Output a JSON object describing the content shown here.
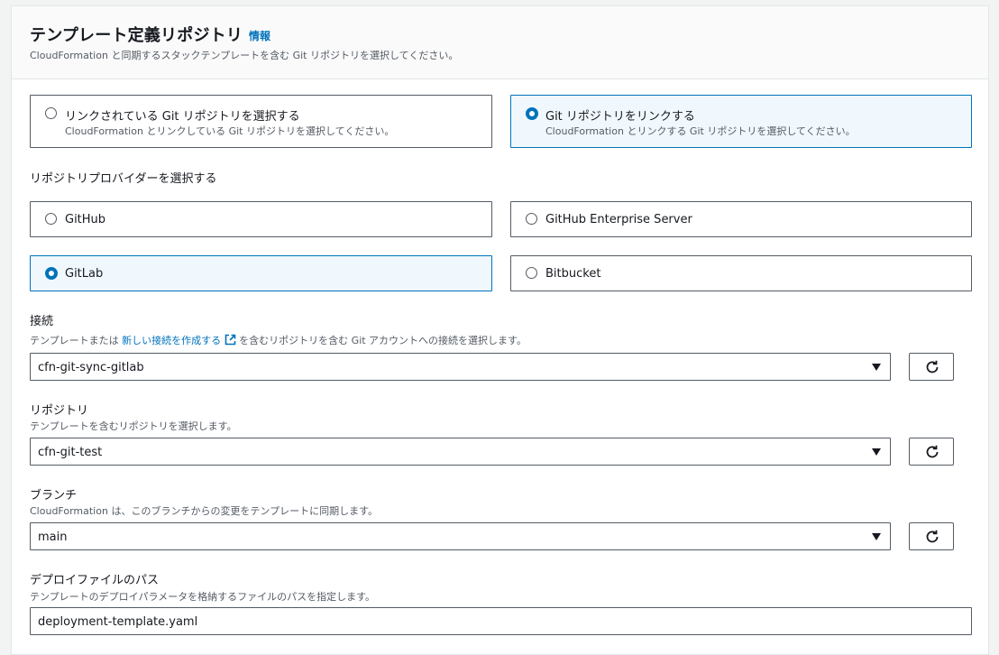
{
  "header": {
    "title": "テンプレート定義リポジトリ",
    "info": "情報",
    "description": "CloudFormation と同期するスタックテンプレートを含む Git リポジトリを選択してください。"
  },
  "repo_mode": {
    "options": [
      {
        "label": "リンクされている Git リポジトリを選択する",
        "description": "CloudFormation とリンクしている Git リポジトリを選択してください。",
        "selected": false
      },
      {
        "label": "Git リポジトリをリンクする",
        "description": "CloudFormation とリンクする Git リポジトリを選択してください。",
        "selected": true
      }
    ]
  },
  "provider": {
    "label": "リポジトリプロバイダーを選択する",
    "options": [
      {
        "label": "GitHub",
        "selected": false
      },
      {
        "label": "GitHub Enterprise Server",
        "selected": false
      },
      {
        "label": "GitLab",
        "selected": true
      },
      {
        "label": "Bitbucket",
        "selected": false
      }
    ]
  },
  "connection": {
    "label": "接続",
    "desc_prefix": "テンプレートまたは",
    "desc_link": "新しい接続を作成する",
    "desc_suffix": "を含むリポジトリを含む Git アカウントへの接続を選択します。",
    "value": "cfn-git-sync-gitlab"
  },
  "repository": {
    "label": "リポジトリ",
    "description": "テンプレートを含むリポジトリを選択します。",
    "value": "cfn-git-test"
  },
  "branch": {
    "label": "ブランチ",
    "description": "CloudFormation は、このブランチからの変更をテンプレートに同期します。",
    "value": "main"
  },
  "deploy_file": {
    "label": "デプロイファイルのパス",
    "description": "テンプレートのデプロイパラメータを格納するファイルのパスを指定します。",
    "value": "deployment-template.yaml"
  },
  "colors": {
    "accent": "#0073bb",
    "border": "#545b64",
    "selected_bg": "#f1f8fd"
  }
}
